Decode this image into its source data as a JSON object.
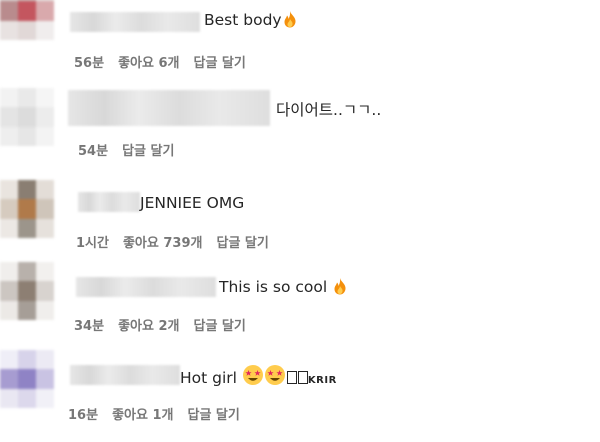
{
  "comments": [
    {
      "text": "Best body",
      "emoji": "fire-emoji",
      "time": "56분",
      "likes": "좋아요 6개",
      "reply": "답글 달기"
    },
    {
      "text": "다이어트..ㄱㄱ..",
      "time": "54분",
      "reply": "답글 달기"
    },
    {
      "text": "JENNIEE OMG",
      "time": "1시간",
      "likes": "좋아요 739개",
      "reply": "답글 달기"
    },
    {
      "text": "This is so cool",
      "emoji": "fire-emoji",
      "time": "34분",
      "likes": "좋아요 2개",
      "reply": "답글 달기"
    },
    {
      "text": "Hot girl",
      "emoji": "star-struck-emoji",
      "suffix": "KRIR",
      "time": "16분",
      "likes": "좋아요 1개",
      "reply": "답글 달기"
    }
  ],
  "colors": {
    "text": "#262626",
    "meta": "#777777",
    "background": "#ffffff"
  }
}
